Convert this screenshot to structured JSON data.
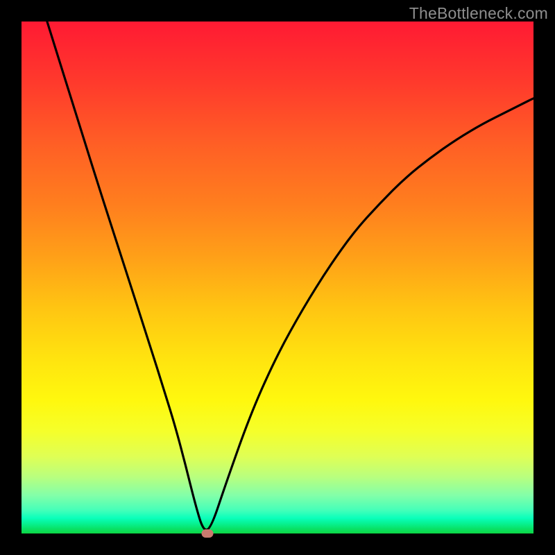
{
  "watermark": "TheBottleneck.com",
  "colors": {
    "background": "#000000",
    "curve_stroke": "#000000",
    "marker_fill": "#c97a6f",
    "gradient_top": "#ff1a33",
    "gradient_bottom": "#0cd544"
  },
  "chart_data": {
    "type": "line",
    "title": "",
    "xlabel": "",
    "ylabel": "",
    "xlim": [
      0,
      100
    ],
    "ylim": [
      0,
      100
    ],
    "grid": false,
    "axes_visible": false,
    "description": "V-shaped bottleneck curve, y ≈ 0 at the minimum and rises sharply toward both sides.",
    "series": [
      {
        "name": "bottleneck-curve",
        "x": [
          5,
          10,
          15,
          20,
          25,
          28,
          30,
          32,
          34,
          35.5,
          37,
          40,
          45,
          50,
          55,
          60,
          65,
          70,
          75,
          80,
          85,
          90,
          95,
          100
        ],
        "y": [
          100,
          84,
          68,
          52.5,
          37,
          27.5,
          21,
          13.5,
          5.5,
          0.5,
          1,
          10,
          24,
          35,
          44,
          52,
          59,
          64.5,
          69.5,
          73.5,
          77,
          80,
          82.5,
          85
        ]
      }
    ],
    "annotations": [
      {
        "name": "optimal-point",
        "shape": "ellipse",
        "x": 36.3,
        "y": 0.0,
        "color": "#c97a6f"
      }
    ]
  }
}
